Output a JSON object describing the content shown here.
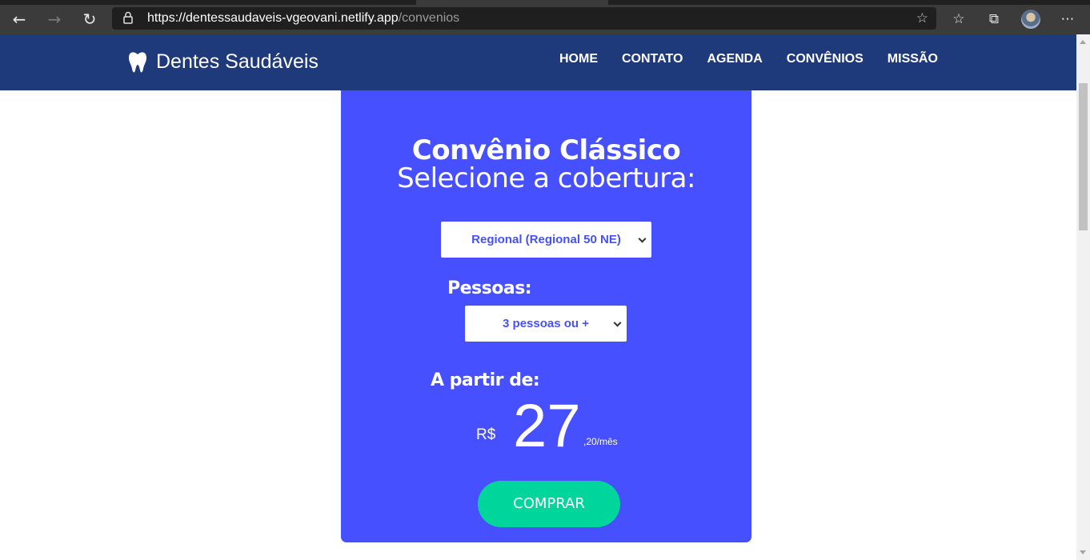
{
  "browser": {
    "url_host": "https://dentessaudaveis-vgeovani.netlify.app",
    "url_path": "/convenios",
    "icons": [
      "back-arrow-icon",
      "forward-arrow-icon",
      "refresh-icon",
      "lock-icon",
      "add-favorite-icon",
      "favorites-icon",
      "collections-icon",
      "profile-avatar",
      "more-icon"
    ]
  },
  "header": {
    "brand": "Dentes Saudáveis",
    "nav": [
      "HOME",
      "CONTATO",
      "AGENDA",
      "CONVÊNIOS",
      "MISSÃO"
    ],
    "bg_color": "#1e3a7b"
  },
  "card": {
    "title": "Convênio Clássico",
    "subtitle": "Selecione a cobertura:",
    "coverage_select": {
      "selected": "Regional (Regional 50 NE)"
    },
    "people_label": "Pessoas:",
    "people_select": {
      "selected": "3 pessoas ou +"
    },
    "from_label": "A partir de:",
    "currency": "R$",
    "price_int": "27",
    "price_dec": ",20/mês",
    "buy_button": "COMPRAR",
    "bg_color": "#4650ff",
    "button_color": "#00d59b"
  }
}
